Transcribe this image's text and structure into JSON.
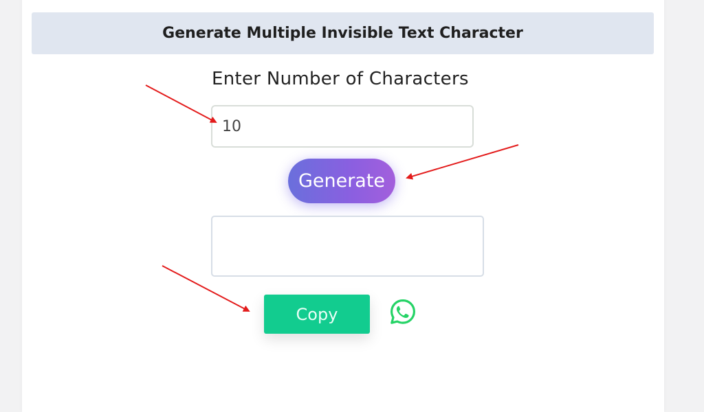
{
  "header": {
    "title": "Generate Multiple Invisible Text Character"
  },
  "form": {
    "label": "Enter Number of Characters",
    "number_value": "10",
    "generate_label": "Generate",
    "output_value": "",
    "copy_label": "Copy"
  },
  "share": {
    "icon": "whatsapp-icon"
  },
  "colors": {
    "header_bg": "#e0e6f0",
    "generate_gradient_start": "#6a6fdc",
    "generate_gradient_end": "#a35fdc",
    "copy_bg": "#12cc8f",
    "whatsapp": "#25d366",
    "arrow": "#e31b1b"
  }
}
